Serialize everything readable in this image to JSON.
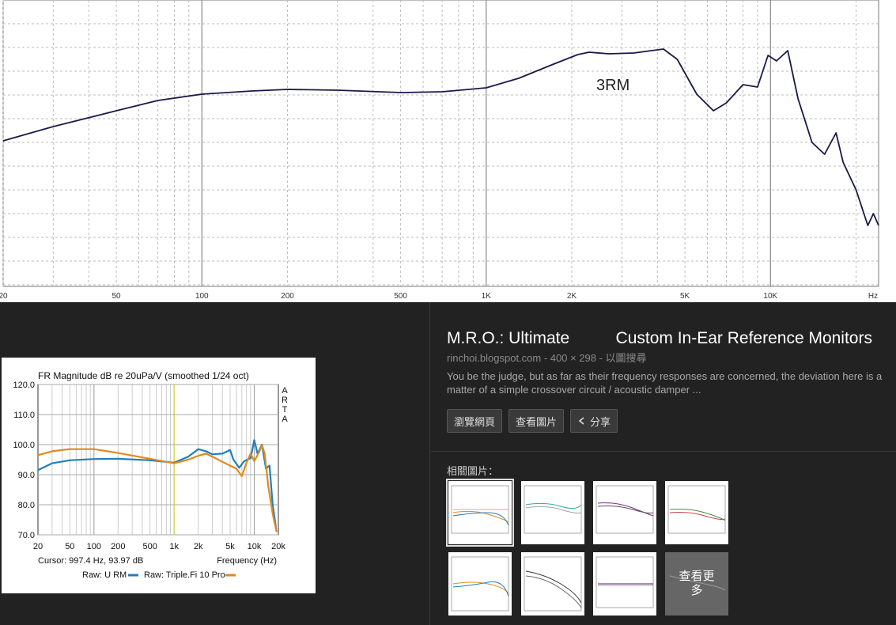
{
  "top_chart": {
    "x_ticks": [
      "20",
      "50",
      "100",
      "200",
      "500",
      "1K",
      "2K",
      "5K",
      "10K",
      "Hz"
    ],
    "annotation": "3RM"
  },
  "arta_chart": {
    "title": "FR Magnitude dB re 20uPa/V (smoothed 1/24 oct)",
    "side_label": [
      "A",
      "R",
      "T",
      "A"
    ],
    "y_ticks": [
      "120.0",
      "110.0",
      "100.0",
      "90.0",
      "80.0",
      "70.0"
    ],
    "x_ticks": [
      "20",
      "50",
      "100",
      "200",
      "500",
      "1k",
      "2k",
      "5k",
      "10k",
      "20k"
    ],
    "cursor": "Cursor: 997.4 Hz, 93.97 dB",
    "xlabel": "Frequency (Hz)",
    "legend": [
      {
        "label": "Raw: U  RM",
        "color": "#1f7fc0"
      },
      {
        "label": "Raw: Triple.Fi 10 Pro",
        "color": "#e08a1e"
      }
    ]
  },
  "chart_data": [
    {
      "type": "line",
      "annotation": "3RM",
      "x_scale": "log",
      "xlim": [
        20,
        24000
      ],
      "series": [
        {
          "values": [
            [
              20,
              -8.3
            ],
            [
              30,
              -6.5
            ],
            [
              50,
              -4.5
            ],
            [
              70,
              -3.2
            ],
            [
              100,
              -2.4
            ],
            [
              150,
              -2.0
            ],
            [
              200,
              -1.8
            ],
            [
              300,
              -1.9
            ],
            [
              500,
              -2.2
            ],
            [
              700,
              -2.1
            ],
            [
              1000,
              -1.6
            ],
            [
              1300,
              -0.4
            ],
            [
              1700,
              1.3
            ],
            [
              2100,
              2.6
            ],
            [
              2300,
              2.9
            ],
            [
              2700,
              2.7
            ],
            [
              3300,
              2.8
            ],
            [
              4200,
              3.3
            ],
            [
              4700,
              2.0
            ],
            [
              5500,
              -2.4
            ],
            [
              6300,
              -4.5
            ],
            [
              7000,
              -3.5
            ],
            [
              8000,
              -1.2
            ],
            [
              9000,
              -1.5
            ],
            [
              9800,
              2.5
            ],
            [
              10500,
              1.8
            ],
            [
              11500,
              3.1
            ],
            [
              12500,
              -3.0
            ],
            [
              14000,
              -8.5
            ],
            [
              15500,
              -10.0
            ],
            [
              17000,
              -7.3
            ],
            [
              18000,
              -11.0
            ],
            [
              20000,
              -14.5
            ],
            [
              22000,
              -19.0
            ],
            [
              23000,
              -17.5
            ],
            [
              24000,
              -19.0
            ]
          ]
        }
      ]
    },
    {
      "type": "line",
      "title": "FR Magnitude dB re 20uPa/V (smoothed 1/24 oct)",
      "xlabel": "Frequency (Hz)",
      "x_scale": "log",
      "xlim": [
        20,
        20000
      ],
      "ylim": [
        70,
        120
      ],
      "series": [
        {
          "name": "Raw: U  RM",
          "color": "#1f7fc0",
          "values": [
            [
              20,
              91.5
            ],
            [
              30,
              93.8
            ],
            [
              50,
              94.8
            ],
            [
              100,
              95.2
            ],
            [
              200,
              95.3
            ],
            [
              500,
              94.8
            ],
            [
              1000,
              94.0
            ],
            [
              1500,
              96.0
            ],
            [
              2000,
              98.5
            ],
            [
              2500,
              97.8
            ],
            [
              3000,
              96.8
            ],
            [
              4000,
              97.0
            ],
            [
              5000,
              98.2
            ],
            [
              5500,
              95.0
            ],
            [
              6500,
              92.3
            ],
            [
              7500,
              94.5
            ],
            [
              9000,
              95.5
            ],
            [
              10000,
              101.5
            ],
            [
              11000,
              97.0
            ],
            [
              12500,
              100.0
            ],
            [
              14000,
              92.0
            ],
            [
              15500,
              93.0
            ],
            [
              17000,
              80.0
            ],
            [
              19000,
              71.0
            ]
          ]
        },
        {
          "name": "Raw: Triple.Fi 10 Pro",
          "color": "#e08a1e",
          "values": [
            [
              20,
              96.5
            ],
            [
              30,
              97.8
            ],
            [
              50,
              98.5
            ],
            [
              100,
              98.5
            ],
            [
              200,
              97.2
            ],
            [
              500,
              95.3
            ],
            [
              1000,
              93.8
            ],
            [
              1500,
              95.0
            ],
            [
              2000,
              96.3
            ],
            [
              2500,
              97.0
            ],
            [
              3000,
              96.0
            ],
            [
              4000,
              94.3
            ],
            [
              5000,
              93.0
            ],
            [
              6000,
              92.0
            ],
            [
              7000,
              89.5
            ],
            [
              8000,
              94.0
            ],
            [
              9000,
              97.0
            ],
            [
              10000,
              94.5
            ],
            [
              11500,
              97.5
            ],
            [
              12500,
              99.8
            ],
            [
              13500,
              97.0
            ],
            [
              15000,
              86.0
            ],
            [
              17000,
              77.0
            ],
            [
              19000,
              71.0
            ]
          ]
        }
      ]
    }
  ],
  "info": {
    "title": "M.R.O.: Ultimate          Custom In-Ear Reference Monitors",
    "meta": "rinchoi.blogspot.com - 400 × 298 - 以圖搜尋",
    "description": "You be the judge, but as far as their frequency responses are concerned, the deviation here is a matter of a simple crossover circuit / acoustic damper ...",
    "buttons": {
      "visit": "瀏覽網頁",
      "view": "查看圖片",
      "share": "分享"
    }
  },
  "related": {
    "label": "相關圖片：",
    "more_label": "查看更\n多"
  },
  "colors": {
    "background": "#222222",
    "curve_top": "#1a1a4a"
  }
}
